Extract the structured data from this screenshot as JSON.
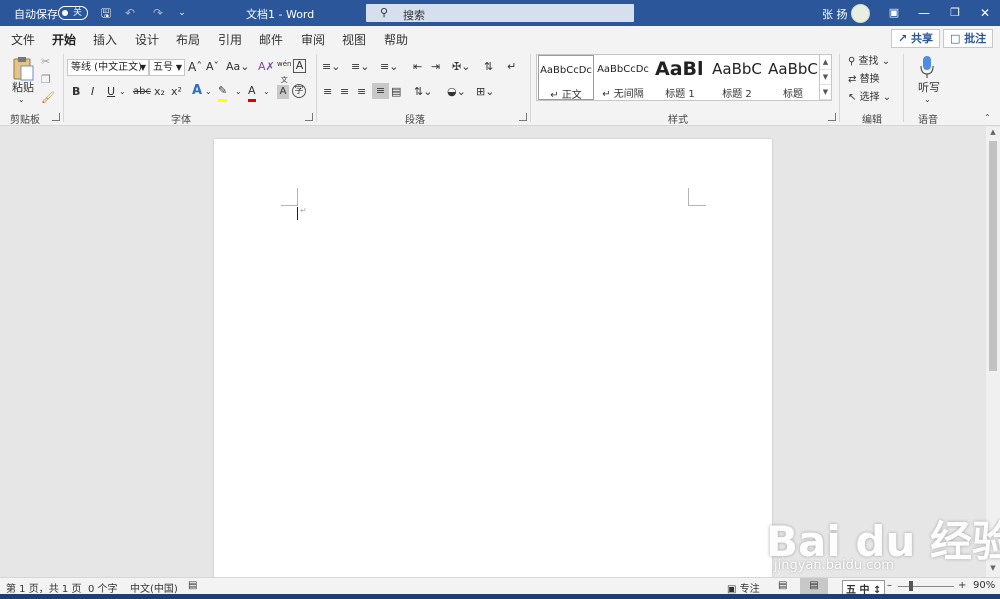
{
  "titlebar": {
    "autosave_label": "自动保存",
    "autosave_state": "关",
    "doc_title": "文档1  -  Word",
    "search_placeholder": "搜索",
    "user_name": "张 扬",
    "bg_color": "#2b579a"
  },
  "tabs": [
    {
      "label": "文件"
    },
    {
      "label": "开始"
    },
    {
      "label": "插入"
    },
    {
      "label": "设计"
    },
    {
      "label": "布局"
    },
    {
      "label": "引用"
    },
    {
      "label": "邮件"
    },
    {
      "label": "审阅"
    },
    {
      "label": "视图"
    },
    {
      "label": "帮助"
    }
  ],
  "tab_actions": {
    "share": "共享",
    "comment": "批注"
  },
  "ribbon": {
    "clipboard": {
      "label": "剪贴板",
      "paste": "粘贴"
    },
    "font": {
      "label": "字体",
      "font_name": "等线 (中文正文)",
      "font_size": "五号",
      "case_btn": "Aa",
      "bold": "B",
      "italic": "I",
      "underline": "U",
      "strike": "abc",
      "sub": "x₂",
      "sup": "x²",
      "clear": "A"
    },
    "paragraph": {
      "label": "段落"
    },
    "styles": {
      "label": "样式",
      "items": [
        {
          "preview": "AaBbCcDc",
          "name": "↵ 正文"
        },
        {
          "preview": "AaBbCcDc",
          "name": "↵ 无间隔"
        },
        {
          "preview": "AaBl",
          "name": "标题 1"
        },
        {
          "preview": "AaBbC",
          "name": "标题 2"
        },
        {
          "preview": "AaBbC",
          "name": "标题"
        }
      ]
    },
    "editing": {
      "label": "编辑",
      "find": "查找",
      "replace": "替换",
      "select": "选择"
    },
    "voice": {
      "label": "语音",
      "dictate": "听写"
    }
  },
  "statusbar": {
    "page": "第 1 页，共 1 页",
    "words": "0 个字",
    "lang": "中文(中国)",
    "focus": "专注",
    "ime_mode": "中",
    "zoom": "90%"
  },
  "watermark": {
    "brand": "Bai du 经验",
    "url": "jingyan.baidu.com"
  }
}
